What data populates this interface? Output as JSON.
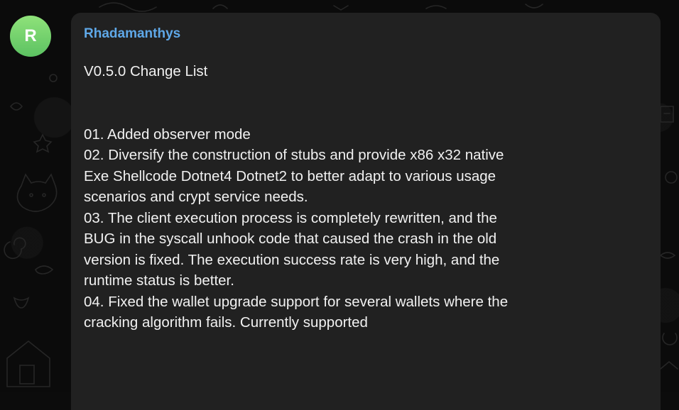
{
  "message": {
    "sender": "Rhadamanthys",
    "avatar_initial": "R",
    "avatar_color": "#6fcf6a",
    "sender_color": "#5fa8e8",
    "title": "V0.5.0 Change List",
    "lines": [
      "01. Added observer mode",
      "02. Diversify the construction of stubs and provide x86 x32 native",
      "Exe Shellcode Dotnet4 Dotnet2 to better adapt to various usage",
      "scenarios and crypt service needs.",
      "03. The client execution process is completely rewritten, and the",
      "BUG in the syscall unhook code that caused the crash in the old",
      "version is fixed. The execution success rate is very high, and the",
      "runtime status is better.",
      "04. Fixed the wallet upgrade support for several wallets where the",
      "cracking algorithm fails. Currently supported"
    ]
  }
}
